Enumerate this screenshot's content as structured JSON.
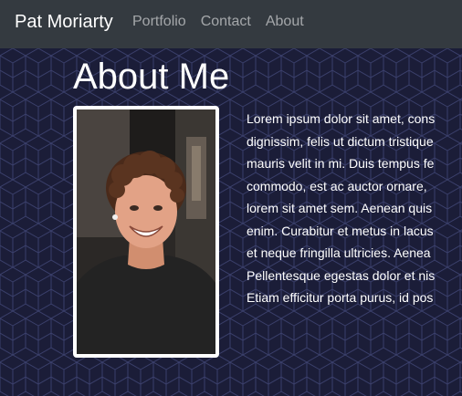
{
  "navbar": {
    "brand": "Pat Moriarty",
    "links": [
      {
        "label": "Portfolio"
      },
      {
        "label": "Contact"
      },
      {
        "label": "About"
      }
    ]
  },
  "about": {
    "title": "About Me",
    "bio_lines": [
      "Lorem ipsum dolor sit amet, cons",
      "dignissim, felis ut dictum tristique",
      "mauris velit in mi. Duis tempus fe",
      "commodo, est ac auctor ornare,",
      "lorem sit amet sem. Aenean quis",
      "enim. Curabitur et metus in lacus",
      "et neque fringilla ultricies. Aenea",
      "Pellentesque egestas dolor et nis",
      "Etiam efficitur porta purus, id pos"
    ]
  },
  "colors": {
    "navbar_bg": "#343a40",
    "page_bg": "#1b1d38",
    "pattern_stroke": "#3a3f6b",
    "text": "#ffffff"
  }
}
